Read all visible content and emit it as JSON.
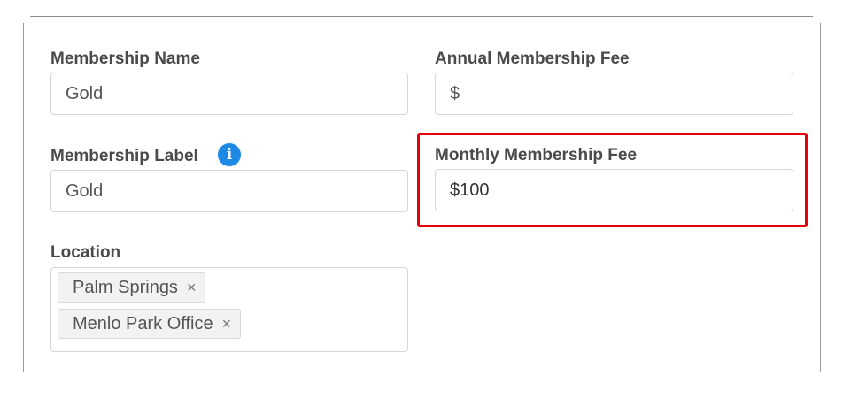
{
  "form": {
    "membership_name": {
      "label": "Membership Name",
      "value": "Gold"
    },
    "annual_fee": {
      "label": "Annual Membership Fee",
      "value": "$"
    },
    "membership_label": {
      "label": "Membership Label",
      "value": "Gold",
      "info_icon_glyph": "i",
      "info_icon": "info-icon",
      "info_icon_color": "#1e88e5"
    },
    "monthly_fee": {
      "label": "Monthly Membership Fee",
      "value": "$100",
      "highlight_color": "#e8000b"
    },
    "location": {
      "label": "Location",
      "tags": [
        {
          "label": "Palm Springs",
          "remove_glyph": "×"
        },
        {
          "label": "Menlo Park Office",
          "remove_glyph": "×"
        }
      ]
    }
  }
}
